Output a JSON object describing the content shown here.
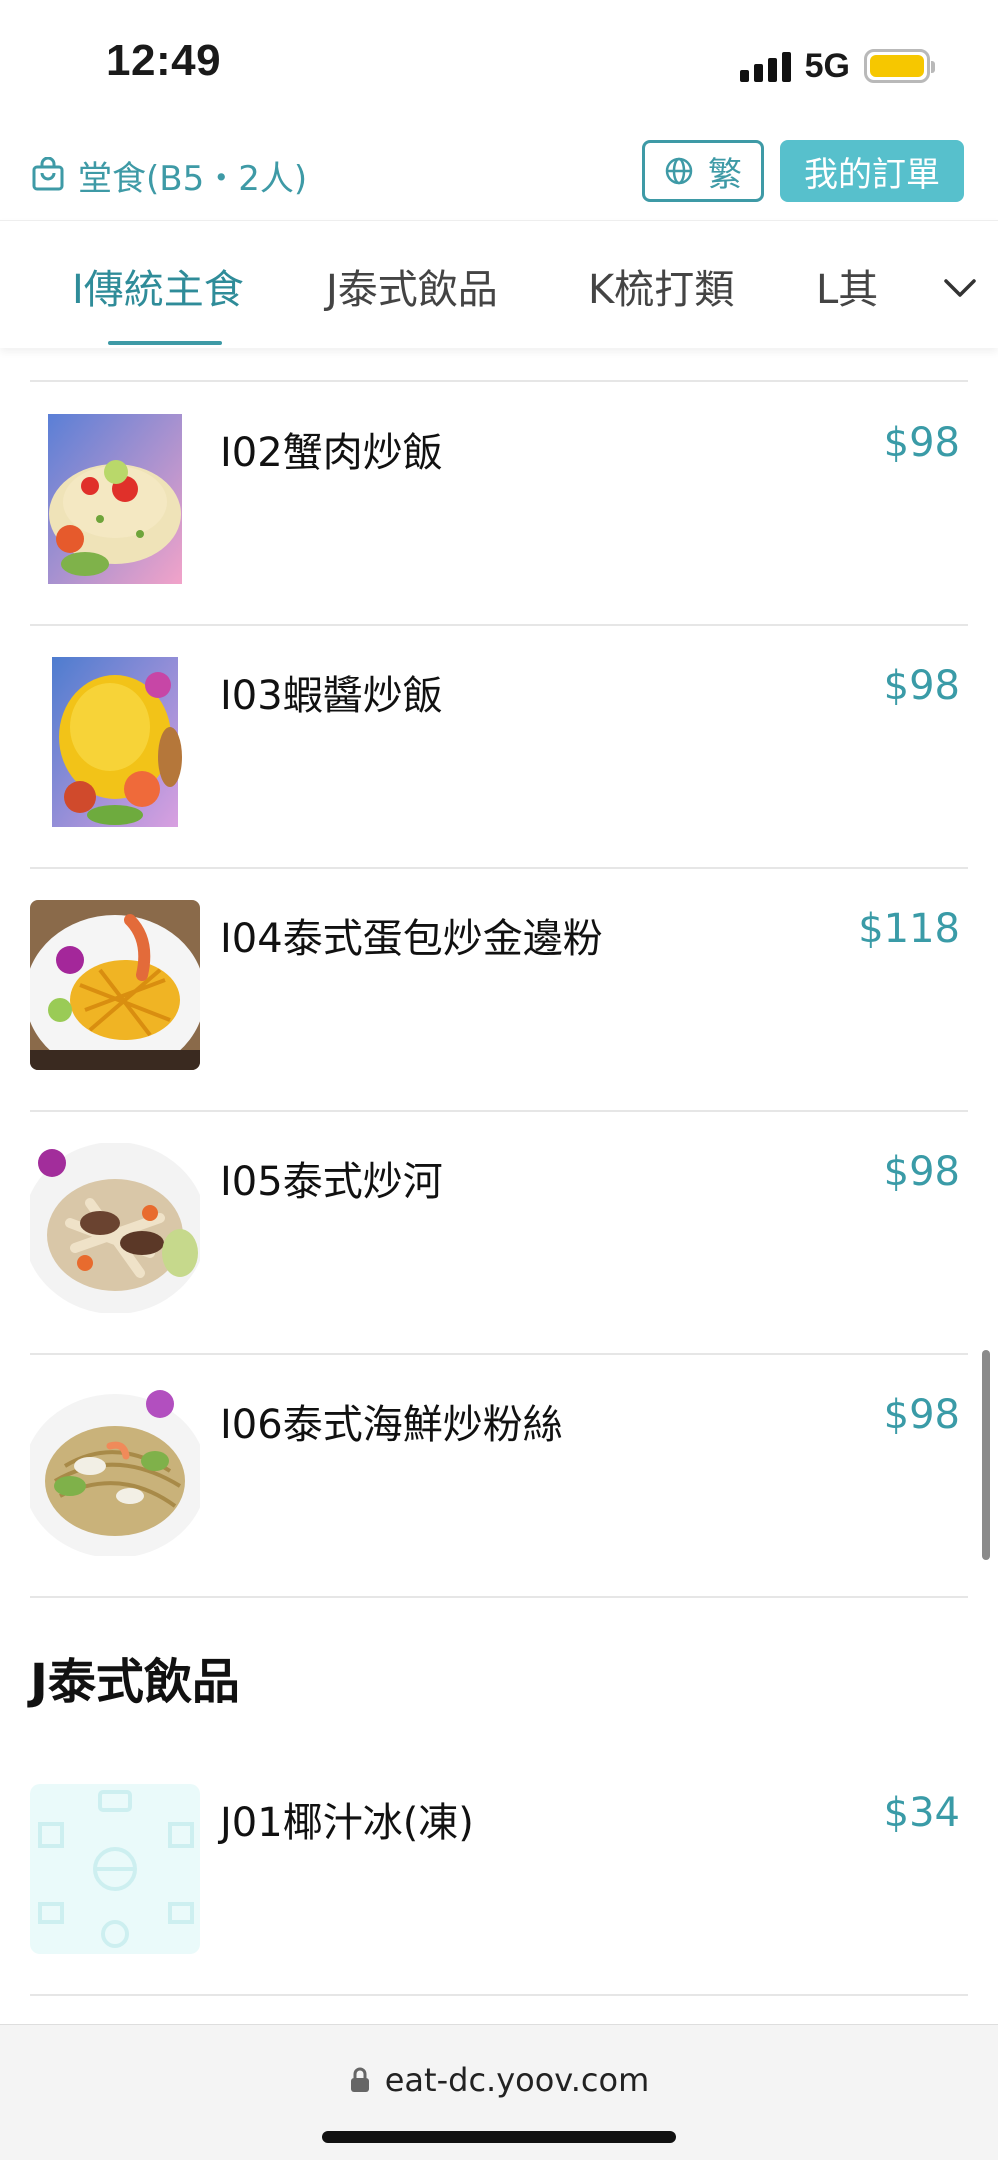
{
  "status_bar": {
    "time": "12:49",
    "network": "5G",
    "battery_color": "#f6c700"
  },
  "header": {
    "dine_info": "堂食(B5・2人)",
    "language_label": "繁",
    "orders_label": "我的訂單",
    "accent_color": "#3e9aa6",
    "orders_bg": "#57c0cc"
  },
  "tabs": {
    "items": [
      "I傳統主食",
      "J泰式飲品",
      "K梳打類",
      "L其"
    ],
    "active_index": 0,
    "more_icon": "chevron-down-icon"
  },
  "menu": {
    "items": [
      {
        "name": "I02蟹肉炒飯",
        "price": "$98"
      },
      {
        "name": "I03蝦醬炒飯",
        "price": "$98"
      },
      {
        "name": "I04泰式蛋包炒金邊粉",
        "price": "$118"
      },
      {
        "name": "I05泰式炒河",
        "price": "$98"
      },
      {
        "name": "I06泰式海鮮炒粉絲",
        "price": "$98"
      }
    ],
    "section_title": "J泰式飲品",
    "section_items": [
      {
        "name": "J01椰汁冰(凍)",
        "price": "$34"
      }
    ]
  },
  "browser": {
    "url": "eat-dc.yoov.com",
    "lock_icon": "lock-icon"
  }
}
